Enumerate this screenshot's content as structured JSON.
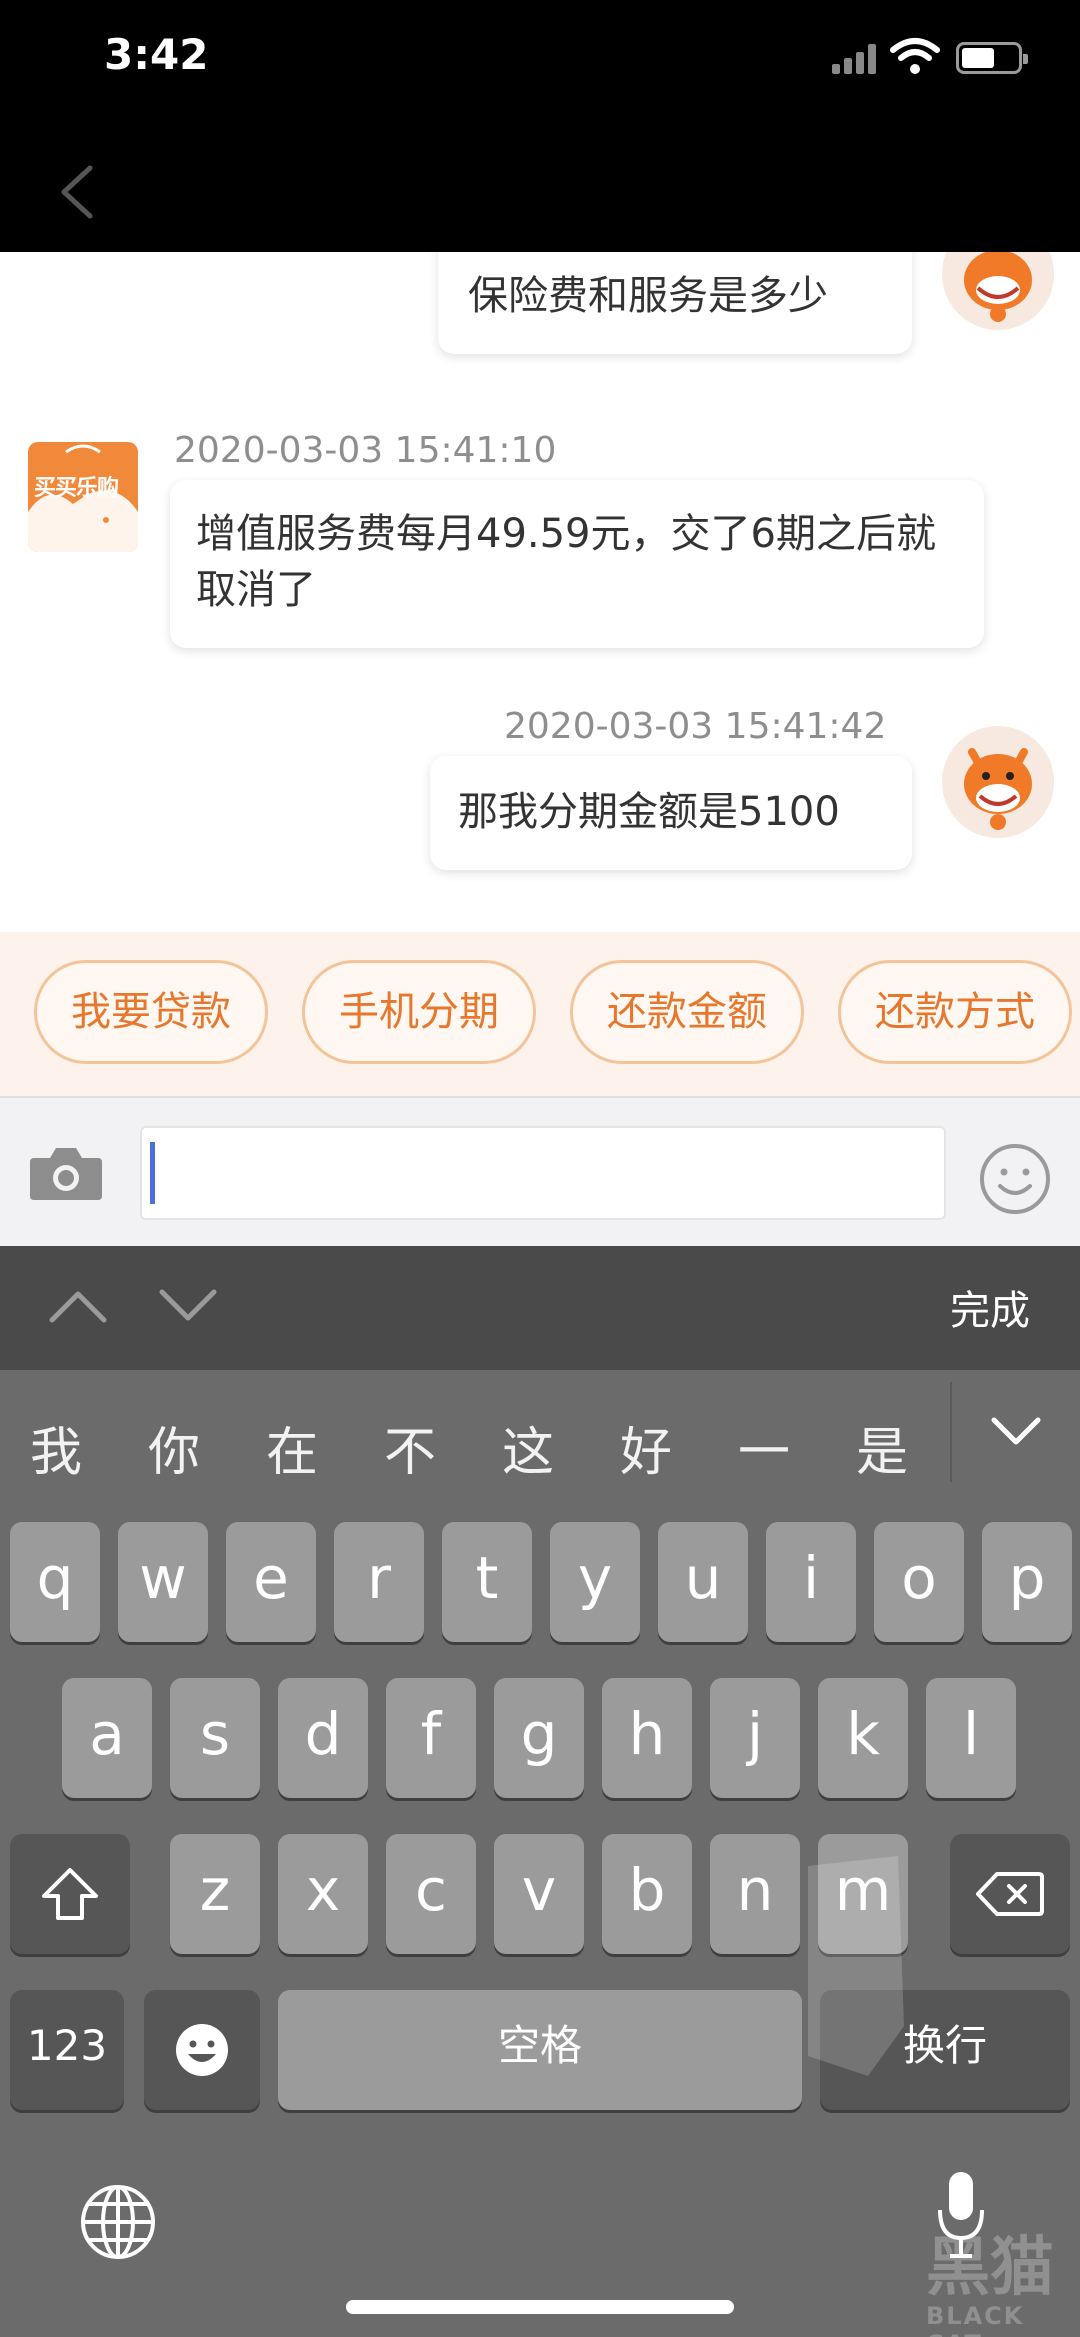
{
  "status_bar": {
    "time": "3:42"
  },
  "messages": [
    {
      "sender": "user",
      "text": "保险费和服务是多少"
    },
    {
      "sender": "bot",
      "timestamp": "2020-03-03 15:41:10",
      "text": "增值服务费每月49.59元，交了6期之后就取消了",
      "avatar_label": "买买乐购"
    },
    {
      "sender": "user",
      "timestamp": "2020-03-03 15:41:42",
      "text": "那我分期金额是5100"
    }
  ],
  "quick_replies": [
    "我要贷款",
    "手机分期",
    "还款金额",
    "还款方式"
  ],
  "input": {
    "value": ""
  },
  "keyboard": {
    "done_label": "完成",
    "candidates": [
      "我",
      "你",
      "在",
      "不",
      "这",
      "好",
      "一",
      "是"
    ],
    "row1": [
      "q",
      "w",
      "e",
      "r",
      "t",
      "y",
      "u",
      "i",
      "o",
      "p"
    ],
    "row2": [
      "a",
      "s",
      "d",
      "f",
      "g",
      "h",
      "j",
      "k",
      "l"
    ],
    "row3": [
      "z",
      "x",
      "c",
      "v",
      "b",
      "n",
      "m"
    ],
    "num_label": "123",
    "space_label": "空格",
    "return_label": "换行"
  },
  "watermark": {
    "text": "黑猫",
    "sub": "BLACK CAT"
  },
  "icons": [
    "back-icon",
    "camera-icon",
    "emoji-icon",
    "chevron-up-icon",
    "chevron-down-icon",
    "shift-icon",
    "delete-icon",
    "globe-icon",
    "microphone-icon"
  ]
}
